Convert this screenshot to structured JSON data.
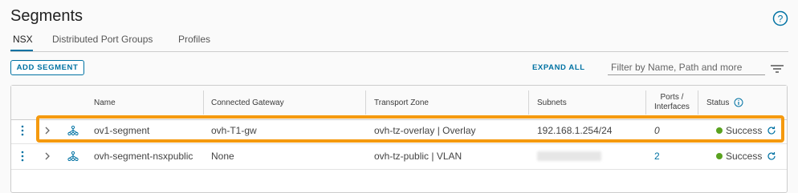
{
  "page": {
    "title": "Segments"
  },
  "tabs": [
    {
      "label": "NSX",
      "active": true
    },
    {
      "label": "Distributed Port Groups",
      "active": false
    },
    {
      "label": "Profiles",
      "active": false
    }
  ],
  "toolbar": {
    "add_label": "ADD SEGMENT",
    "expand_label": "EXPAND ALL",
    "filter_placeholder": "Filter by Name, Path and more"
  },
  "columns": {
    "name": "Name",
    "gateway": "Connected Gateway",
    "zone": "Transport Zone",
    "subnets": "Subnets",
    "ports_line1": "Ports /",
    "ports_line2": "Interfaces",
    "status": "Status"
  },
  "rows": [
    {
      "name": "ov1-segment",
      "gateway": "ovh-T1-gw",
      "zone": "ovh-tz-overlay | Overlay",
      "subnet": "192.168.1.254/24",
      "ports": "0",
      "status": "Success"
    },
    {
      "name": "ovh-segment-nsxpublic",
      "gateway": "None",
      "zone": "ovh-tz-public | VLAN",
      "subnet": "",
      "ports": "2",
      "status": "Success"
    }
  ],
  "colors": {
    "accent": "#0072a3",
    "success": "#5aa220",
    "highlight": "#f59a0f"
  }
}
